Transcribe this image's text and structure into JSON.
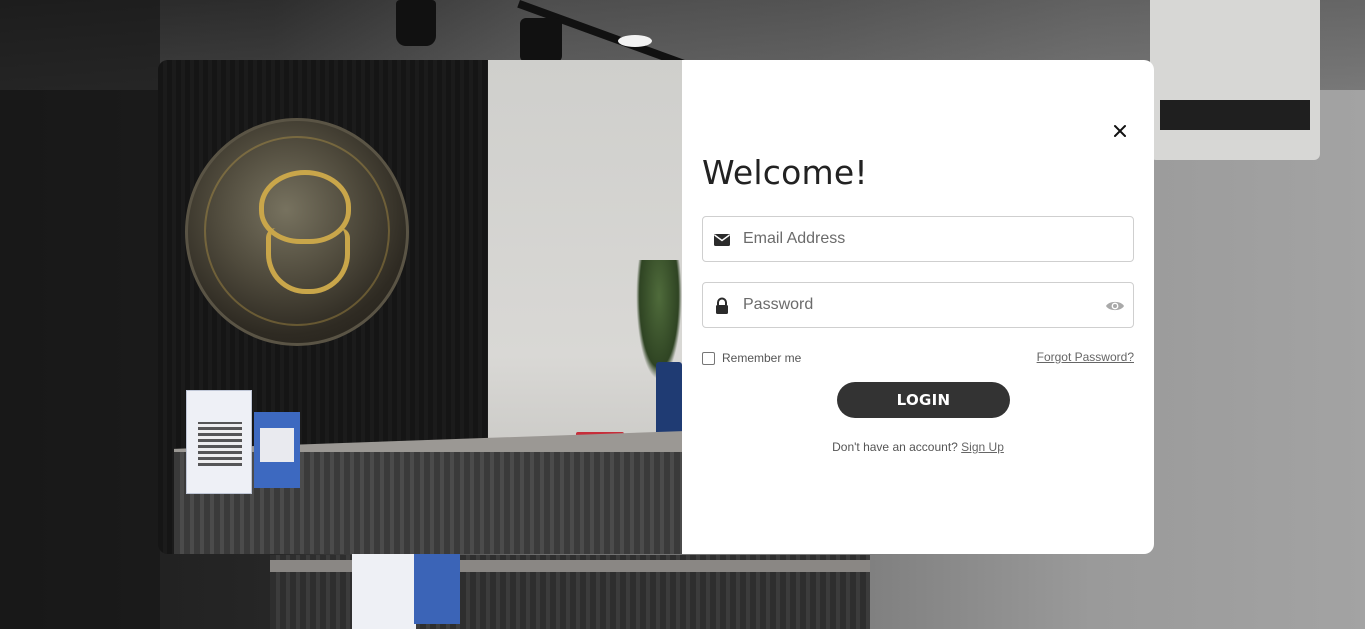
{
  "modal": {
    "title": "Welcome!",
    "close_icon": "close-icon"
  },
  "form": {
    "email": {
      "placeholder": "Email Address",
      "value": "",
      "icon": "envelope-icon"
    },
    "password": {
      "placeholder": "Password",
      "value": "",
      "icon": "lock-icon",
      "toggle_icon": "eye-icon"
    },
    "remember_label": "Remember me",
    "remember_checked": false,
    "forgot_label": "Forgot Password?",
    "login_label": "LOGIN",
    "signup_prompt": "Don't have an account?",
    "signup_link": "Sign Up"
  },
  "colors": {
    "button_bg": "#333333",
    "card_bg": "#ffffff",
    "text": "#222222"
  }
}
